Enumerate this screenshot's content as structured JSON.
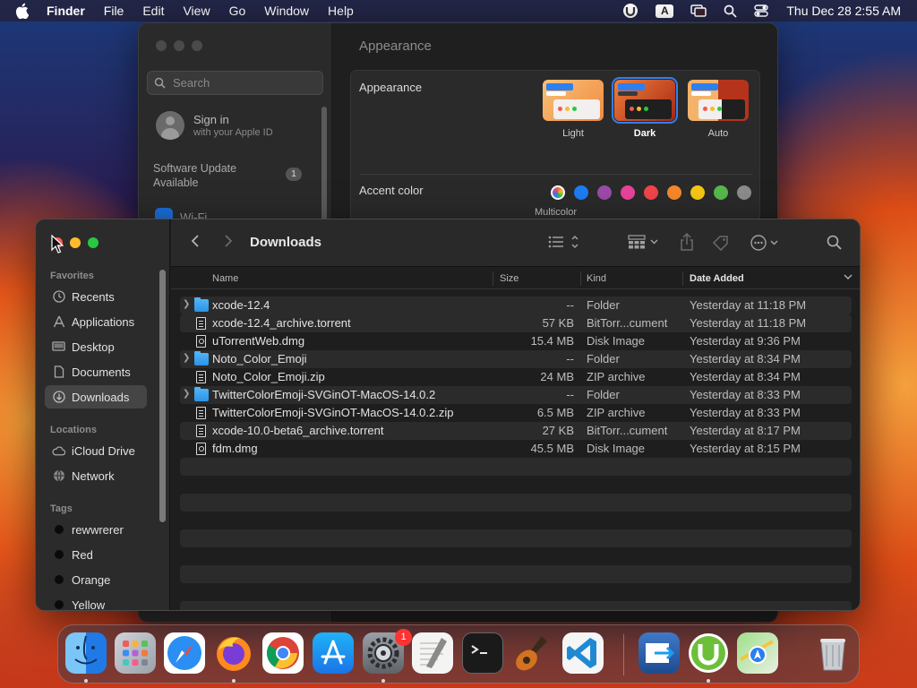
{
  "menubar": {
    "app_name": "Finder",
    "menus": [
      "File",
      "Edit",
      "View",
      "Go",
      "Window",
      "Help"
    ],
    "input_indicator": "A",
    "clock": "Thu Dec 28  2:55 AM"
  },
  "settings": {
    "header": "Appearance",
    "search_placeholder": "Search",
    "signin_title": "Sign in",
    "signin_sub": "with your Apple ID",
    "update_line1": "Software Update",
    "update_line2": "Available",
    "update_badge": "1",
    "wifi_label": "Wi-Fi",
    "appearance_label": "Appearance",
    "themes": [
      {
        "label": "Light",
        "selected": false
      },
      {
        "label": "Dark",
        "selected": true
      },
      {
        "label": "Auto",
        "selected": false
      }
    ],
    "accent_label": "Accent color",
    "multicolor_label": "Multicolor",
    "accent_colors": [
      "#9b59b6",
      "#1e7cf2",
      "#9b4ba8",
      "#e8439a",
      "#f0454b",
      "#f5882a",
      "#f6c616",
      "#56b84b",
      "#8c8c8c"
    ]
  },
  "finder": {
    "title": "Downloads",
    "sidebar": {
      "favorites_label": "Favorites",
      "favorites": [
        {
          "label": "Recents",
          "icon": "clock-icon"
        },
        {
          "label": "Applications",
          "icon": "applications-icon"
        },
        {
          "label": "Desktop",
          "icon": "desktop-icon"
        },
        {
          "label": "Documents",
          "icon": "document-icon"
        },
        {
          "label": "Downloads",
          "icon": "download-icon",
          "active": true
        }
      ],
      "locations_label": "Locations",
      "locations": [
        {
          "label": "iCloud Drive",
          "icon": "cloud-icon"
        },
        {
          "label": "Network",
          "icon": "globe-icon"
        }
      ],
      "tags_label": "Tags",
      "tags": [
        {
          "label": "rewwrerer",
          "color": "#111111"
        },
        {
          "label": "Red",
          "color": "#111111"
        },
        {
          "label": "Orange",
          "color": "#111111"
        },
        {
          "label": "Yellow",
          "color": "#111111"
        }
      ]
    },
    "columns": {
      "name": "Name",
      "size": "Size",
      "kind": "Kind",
      "date": "Date Added"
    },
    "files": [
      {
        "name": "xcode-12.4",
        "size": "--",
        "kind": "Folder",
        "date": "Yesterday at 11:18 PM",
        "type": "folder"
      },
      {
        "name": "xcode-12.4_archive.torrent",
        "size": "57 KB",
        "kind": "BitTorr...cument",
        "date": "Yesterday at 11:18 PM",
        "type": "file"
      },
      {
        "name": "uTorrentWeb.dmg",
        "size": "15.4 MB",
        "kind": "Disk Image",
        "date": "Yesterday at 9:36 PM",
        "type": "disk"
      },
      {
        "name": "Noto_Color_Emoji",
        "size": "--",
        "kind": "Folder",
        "date": "Yesterday at 8:34 PM",
        "type": "folder"
      },
      {
        "name": "Noto_Color_Emoji.zip",
        "size": "24 MB",
        "kind": "ZIP archive",
        "date": "Yesterday at 8:34 PM",
        "type": "file"
      },
      {
        "name": "TwitterColorEmoji-SVGinOT-MacOS-14.0.2",
        "size": "--",
        "kind": "Folder",
        "date": "Yesterday at 8:33 PM",
        "type": "folder"
      },
      {
        "name": "TwitterColorEmoji-SVGinOT-MacOS-14.0.2.zip",
        "size": "6.5 MB",
        "kind": "ZIP archive",
        "date": "Yesterday at 8:33 PM",
        "type": "file"
      },
      {
        "name": "xcode-10.0-beta6_archive.torrent",
        "size": "27 KB",
        "kind": "BitTorr...cument",
        "date": "Yesterday at 8:17 PM",
        "type": "file"
      },
      {
        "name": "fdm.dmg",
        "size": "45.5 MB",
        "kind": "Disk Image",
        "date": "Yesterday at 8:15 PM",
        "type": "disk"
      }
    ]
  },
  "dock": {
    "apps": [
      "finder-icon",
      "launchpad-icon",
      "safari-icon",
      "firefox-icon",
      "chrome-icon",
      "app-store-icon",
      "system-settings-icon",
      "textedit-icon",
      "terminal-icon",
      "garageband-icon",
      "vscode-icon",
      "migration-assistant-icon",
      "utorrent-icon",
      "maps-icon",
      "trash-icon"
    ],
    "settings_badge": "1"
  }
}
